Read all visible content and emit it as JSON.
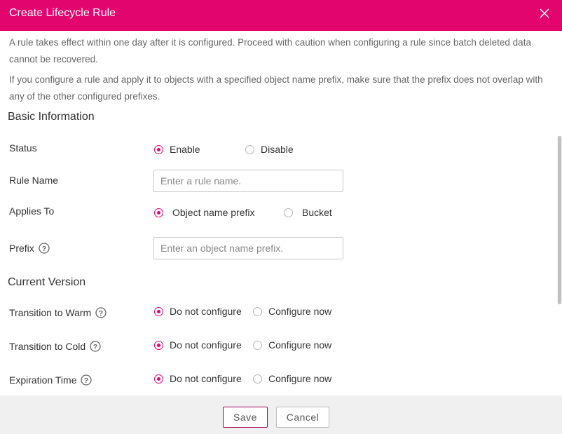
{
  "dialog": {
    "title": "Create Lifecycle Rule",
    "close_icon": "close-icon",
    "notices": [
      "A rule takes effect within one day after it is configured. Proceed with caution when configuring a rule since batch deleted data cannot be recovered.",
      "If you configure a rule and apply it to objects with a specified object name prefix, make sure that the prefix does not overlap with any of the other configured prefixes."
    ],
    "accent_color": "#e3056e"
  },
  "basic_info": {
    "heading": "Basic Information",
    "status": {
      "label": "Status",
      "options": [
        "Enable",
        "Disable"
      ],
      "selected": "Enable"
    },
    "rule_name": {
      "label": "Rule Name",
      "placeholder": "Enter a rule name.",
      "value": ""
    },
    "applies_to": {
      "label": "Applies To",
      "options": [
        "Object name prefix",
        "Bucket"
      ],
      "selected": "Object name prefix"
    },
    "prefix": {
      "label": "Prefix",
      "help_icon": "question-circle-icon",
      "placeholder": "Enter an object name prefix.",
      "value": ""
    }
  },
  "current_version": {
    "heading": "Current Version",
    "rows": [
      {
        "label": "Transition to Warm",
        "help_icon": "question-circle-icon",
        "options": [
          "Do not configure",
          "Configure now"
        ],
        "selected": "Do not configure"
      },
      {
        "label": "Transition to Cold",
        "help_icon": "question-circle-icon",
        "options": [
          "Do not configure",
          "Configure now"
        ],
        "selected": "Do not configure"
      },
      {
        "label": "Expiration Time",
        "help_icon": "question-circle-icon",
        "options": [
          "Do not configure",
          "Configure now"
        ],
        "selected": "Do not configure"
      }
    ]
  },
  "footer": {
    "save_label": "Save",
    "cancel_label": "Cancel"
  }
}
